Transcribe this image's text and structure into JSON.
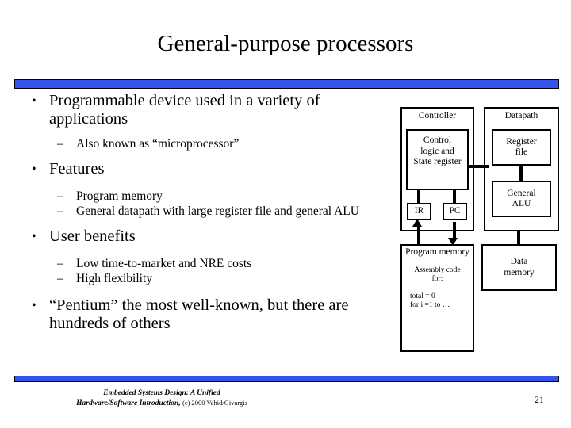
{
  "slide": {
    "title": "General-purpose processors",
    "page_number": "21",
    "accent_color": "#3355ee",
    "text_color": "#000000",
    "background_color": "#ffffff"
  },
  "body": {
    "bullets": [
      {
        "level": 1,
        "mark": "•",
        "text": "Programmable device used in a variety of applications"
      },
      {
        "level": 2,
        "mark": "–",
        "text": "Also known as “microprocessor”"
      },
      {
        "level": 1,
        "mark": "•",
        "text": "Features"
      },
      {
        "level": 2,
        "mark": "–",
        "text": "Program memory"
      },
      {
        "level": 2,
        "mark": "–",
        "text": "General datapath with large register file and general ALU"
      },
      {
        "level": 1,
        "mark": "•",
        "text": "User benefits"
      },
      {
        "level": 2,
        "mark": "–",
        "text": "Low time-to-market and NRE costs"
      },
      {
        "level": 2,
        "mark": "–",
        "text": "High flexibility"
      },
      {
        "level": 1,
        "mark": "•",
        "text": "“Pentium” the most well-known, but there are hundreds of others"
      }
    ]
  },
  "diagram": {
    "controller_label": "Controller",
    "datapath_label": "Datapath",
    "control_logic_line1": "Control",
    "control_logic_line2": "logic and",
    "control_logic_line3": "State register",
    "ir_label": "IR",
    "pc_label": "PC",
    "register_file_line1": "Register",
    "register_file_line2": "file",
    "alu_line1": "General",
    "alu_line2": "ALU",
    "program_memory_line1": "Program",
    "program_memory_line2": "memory",
    "assembly_line1": "Assembly code",
    "assembly_line2": "for:",
    "code_line1": "total = 0",
    "code_line2": "for i =1 to …",
    "data_memory_line1": "Data",
    "data_memory_line2": "memory"
  },
  "footer": {
    "line1": "Embedded Systems Design: A Unified",
    "line2": "Hardware/Software Introduction,",
    "copyright": "(c) 2000 Vahid/Givargis"
  }
}
